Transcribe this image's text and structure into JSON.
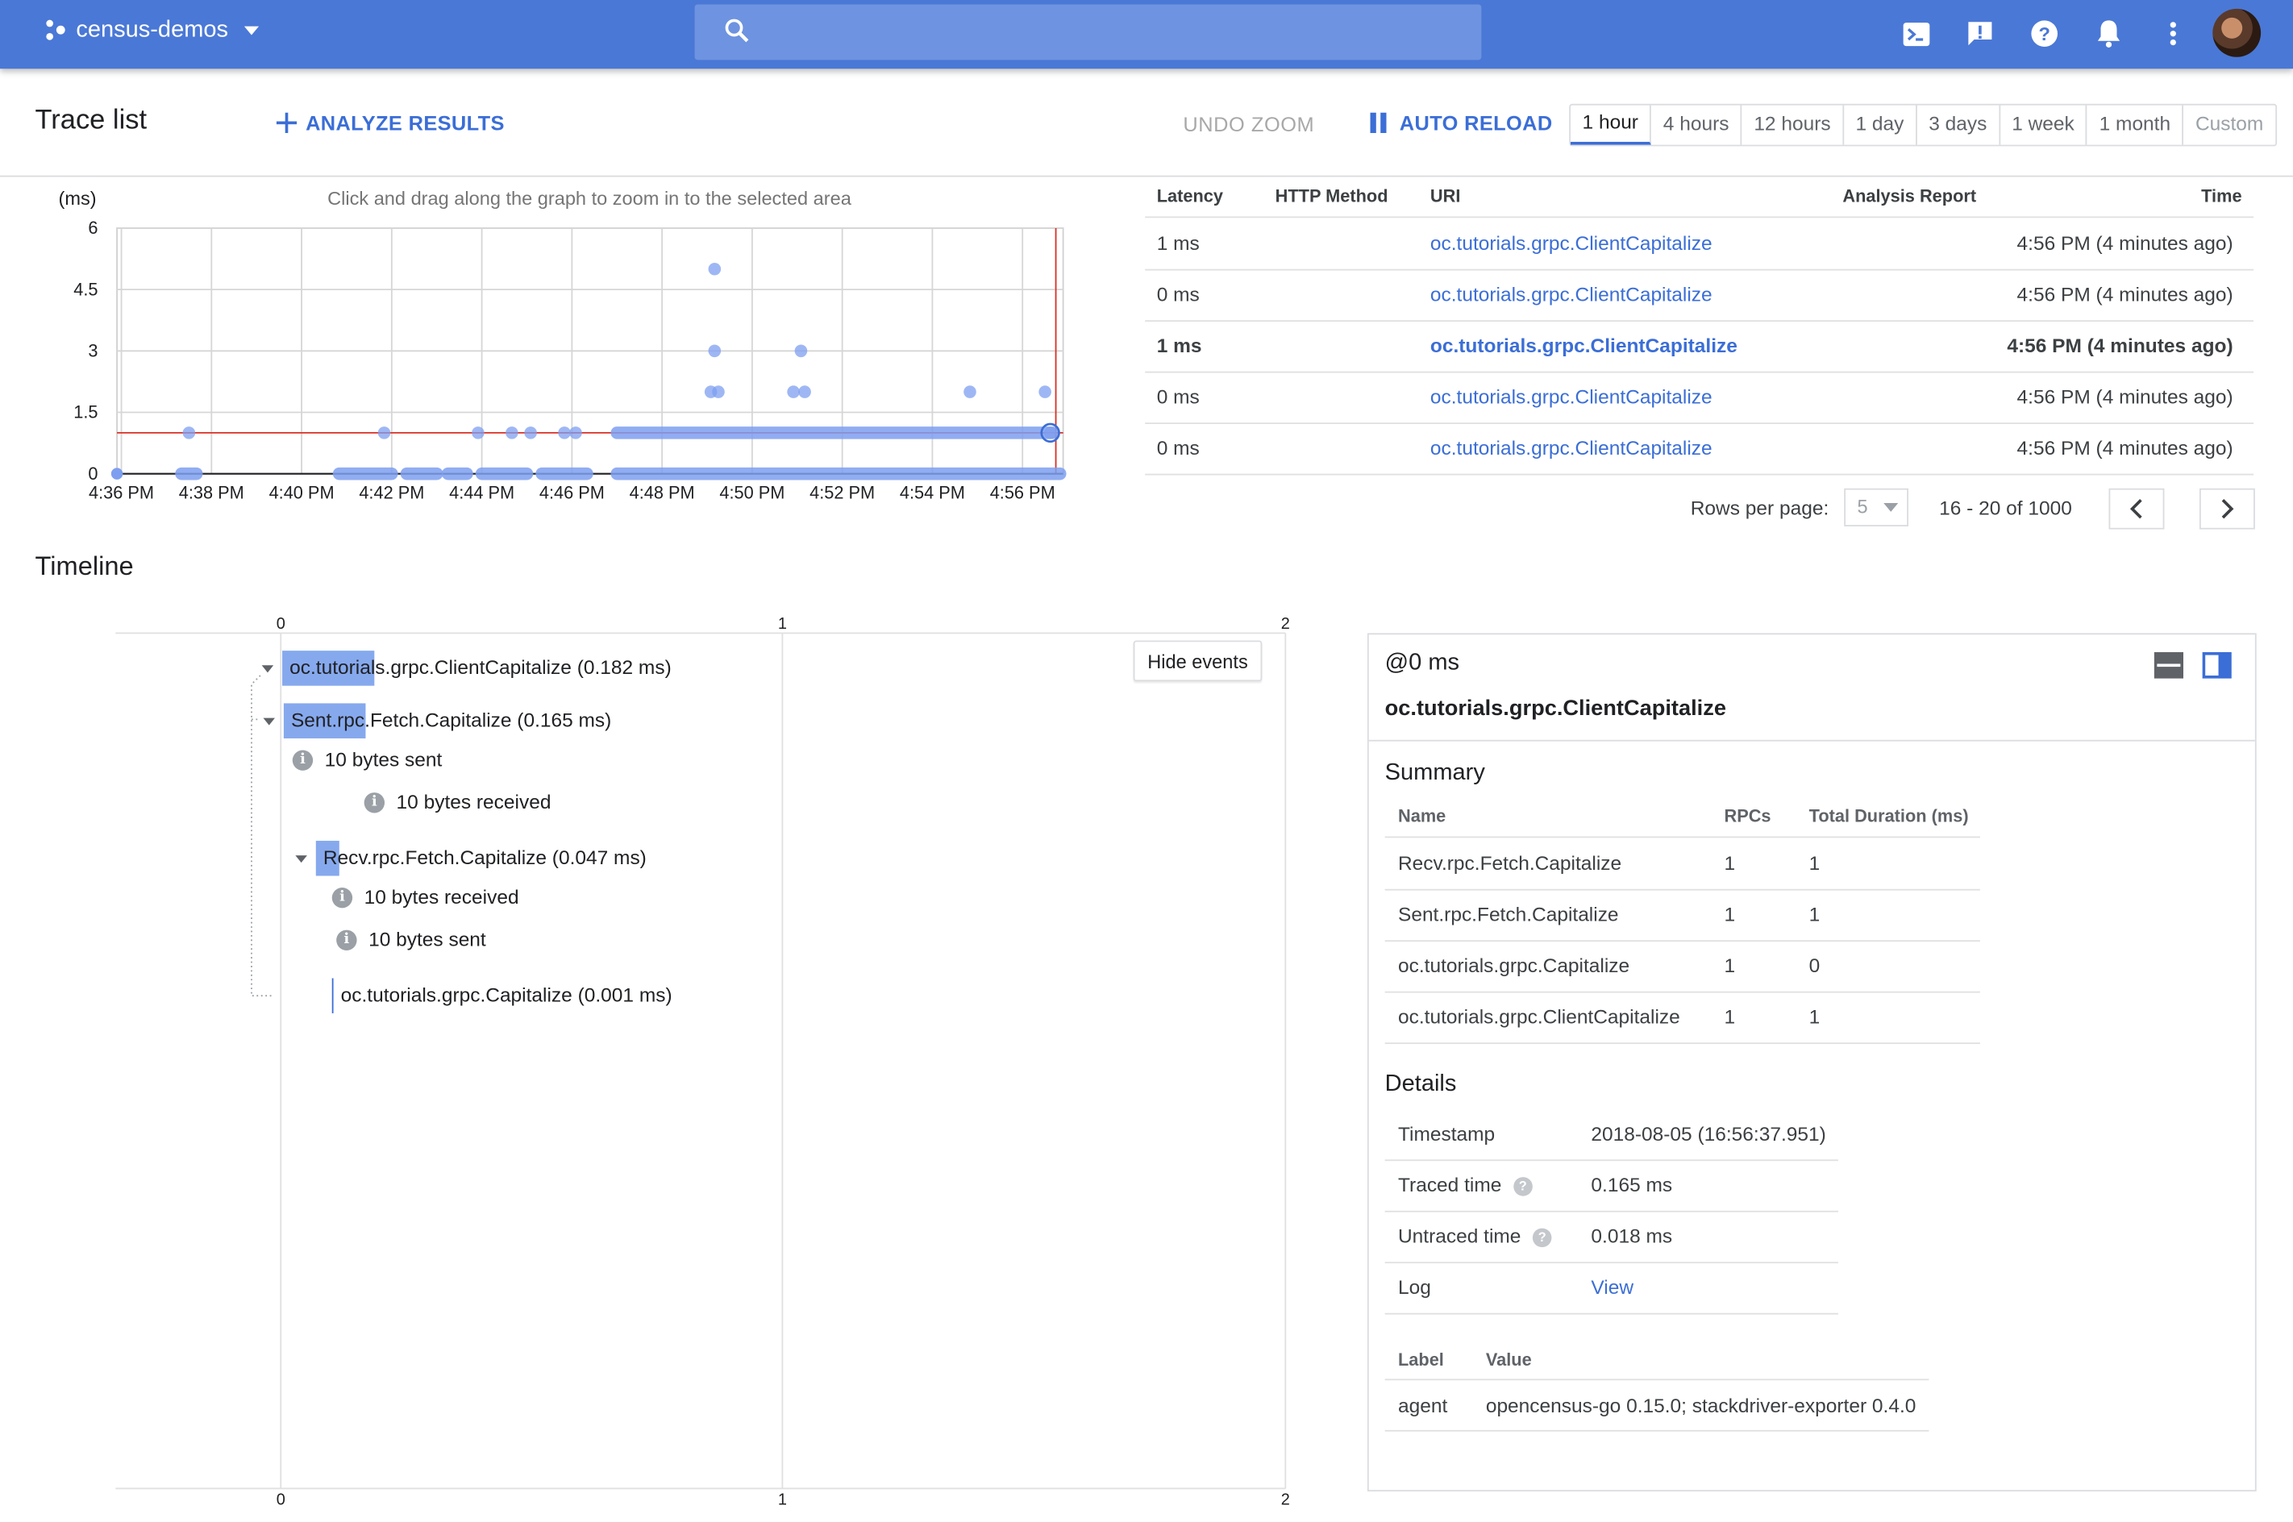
{
  "topbar": {
    "project": "census-demos",
    "search_placeholder": "",
    "icons": [
      "cloud-shell-icon",
      "notification-alert-icon",
      "help-icon",
      "bell-icon",
      "more-vert-icon"
    ]
  },
  "header": {
    "title": "Trace list",
    "analyze_label": "ANALYZE RESULTS",
    "undo_zoom_label": "UNDO ZOOM",
    "auto_reload_label": "AUTO RELOAD",
    "time_ranges": [
      "1 hour",
      "4 hours",
      "12 hours",
      "1 day",
      "3 days",
      "1 week",
      "1 month",
      "Custom"
    ],
    "selected_range": "1 hour"
  },
  "chart_data": {
    "type": "scatter",
    "ylabel": "(ms)",
    "hint": "Click and drag along the graph to zoom in to the selected area",
    "yticks": [
      "6",
      "4.5",
      "3",
      "1.5",
      "0"
    ],
    "ylim": [
      0,
      6
    ],
    "xticks": [
      "4:36 PM",
      "4:38 PM",
      "4:40 PM",
      "4:42 PM",
      "4:44 PM",
      "4:46 PM",
      "4:48 PM",
      "4:50 PM",
      "4:52 PM",
      "4:54 PM",
      "4:56 PM"
    ],
    "threshold_y": 1,
    "series": [
      {
        "points": [
          [
            "4:37:30 PM",
            1
          ],
          [
            "4:41:50 PM",
            1
          ],
          [
            "4:43:55 PM",
            1
          ],
          [
            "4:44:40 PM",
            1
          ],
          [
            "4:45:05 PM",
            1
          ],
          [
            "4:45:50 PM",
            1
          ],
          [
            "4:46:05 PM",
            1
          ],
          [
            "4:49:10 PM",
            5
          ],
          [
            "4:49:10 PM",
            3
          ],
          [
            "4:49:05 PM",
            2
          ],
          [
            "4:49:15 PM",
            2
          ],
          [
            "4:51:05 PM",
            3
          ],
          [
            "4:50:55 PM",
            2
          ],
          [
            "4:51:10 PM",
            2
          ],
          [
            "4:54:50 PM",
            2
          ],
          [
            "4:56:30 PM",
            2
          ],
          [
            "4:56:37 PM",
            1
          ]
        ]
      }
    ],
    "grid": true,
    "colors": {
      "point": "#7e9ff0",
      "threshold": "#d93025",
      "axis": "#202124"
    }
  },
  "trace_table": {
    "columns": [
      "Latency",
      "HTTP Method",
      "URI",
      "Analysis Report",
      "Time"
    ],
    "rows": [
      {
        "latency": "1 ms",
        "method": "",
        "uri": "oc.tutorials.grpc.ClientCapitalize",
        "time": "4:56 PM  (4 minutes ago)",
        "bold": false
      },
      {
        "latency": "0 ms",
        "method": "",
        "uri": "oc.tutorials.grpc.ClientCapitalize",
        "time": "4:56 PM  (4 minutes ago)",
        "bold": false
      },
      {
        "latency": "1 ms",
        "method": "",
        "uri": "oc.tutorials.grpc.ClientCapitalize",
        "time": "4:56 PM  (4 minutes ago)",
        "bold": true
      },
      {
        "latency": "0 ms",
        "method": "",
        "uri": "oc.tutorials.grpc.ClientCapitalize",
        "time": "4:56 PM  (4 minutes ago)",
        "bold": false
      },
      {
        "latency": "0 ms",
        "method": "",
        "uri": "oc.tutorials.grpc.ClientCapitalize",
        "time": "4:56 PM  (4 minutes ago)",
        "bold": false
      }
    ],
    "rows_per_page_label": "Rows per page:",
    "rows_per_page": "5",
    "range": "16 - 20 of 1000"
  },
  "timeline": {
    "title": "Timeline",
    "axis_ticks": [
      "0",
      "1",
      "2"
    ],
    "hide_events_label": "Hide events",
    "spans": [
      {
        "label": "oc.tutorials.grpc.ClientCapitalize (0.182 ms)",
        "start_ms": 0,
        "duration_ms": 0.182
      },
      {
        "label": "Sent.rpc.Fetch.Capitalize (0.165 ms)",
        "start_ms": 0,
        "duration_ms": 0.165
      },
      {
        "label": "Recv.rpc.Fetch.Capitalize (0.047 ms)",
        "start_ms": 0.07,
        "duration_ms": 0.047
      },
      {
        "label": "oc.tutorials.grpc.Capitalize (0.001 ms)",
        "start_ms": 0.105,
        "duration_ms": 0.001
      }
    ],
    "events": [
      "10 bytes sent",
      "10 bytes received",
      "10 bytes received",
      "10 bytes sent"
    ]
  },
  "details": {
    "offset": "@0 ms",
    "span_name": "oc.tutorials.grpc.ClientCapitalize",
    "summary_title": "Summary",
    "summary_columns": [
      "Name",
      "RPCs",
      "Total Duration (ms)"
    ],
    "summary_rows": [
      {
        "name": "Recv.rpc.Fetch.Capitalize",
        "rpcs": "1",
        "duration": "1"
      },
      {
        "name": "Sent.rpc.Fetch.Capitalize",
        "rpcs": "1",
        "duration": "1"
      },
      {
        "name": "oc.tutorials.grpc.Capitalize",
        "rpcs": "1",
        "duration": "0"
      },
      {
        "name": "oc.tutorials.grpc.ClientCapitalize",
        "rpcs": "1",
        "duration": "1"
      }
    ],
    "details_title": "Details",
    "timestamp_label": "Timestamp",
    "timestamp": "2018-08-05 (16:56:37.951)",
    "traced_label": "Traced time",
    "traced": "0.165 ms",
    "untraced_label": "Untraced time",
    "untraced": "0.018 ms",
    "log_label": "Log",
    "log_link": "View",
    "label_columns": [
      "Label",
      "Value"
    ],
    "labels": [
      {
        "label": "agent",
        "value": "opencensus-go 0.15.0; stackdriver-exporter 0.4.0"
      }
    ]
  }
}
